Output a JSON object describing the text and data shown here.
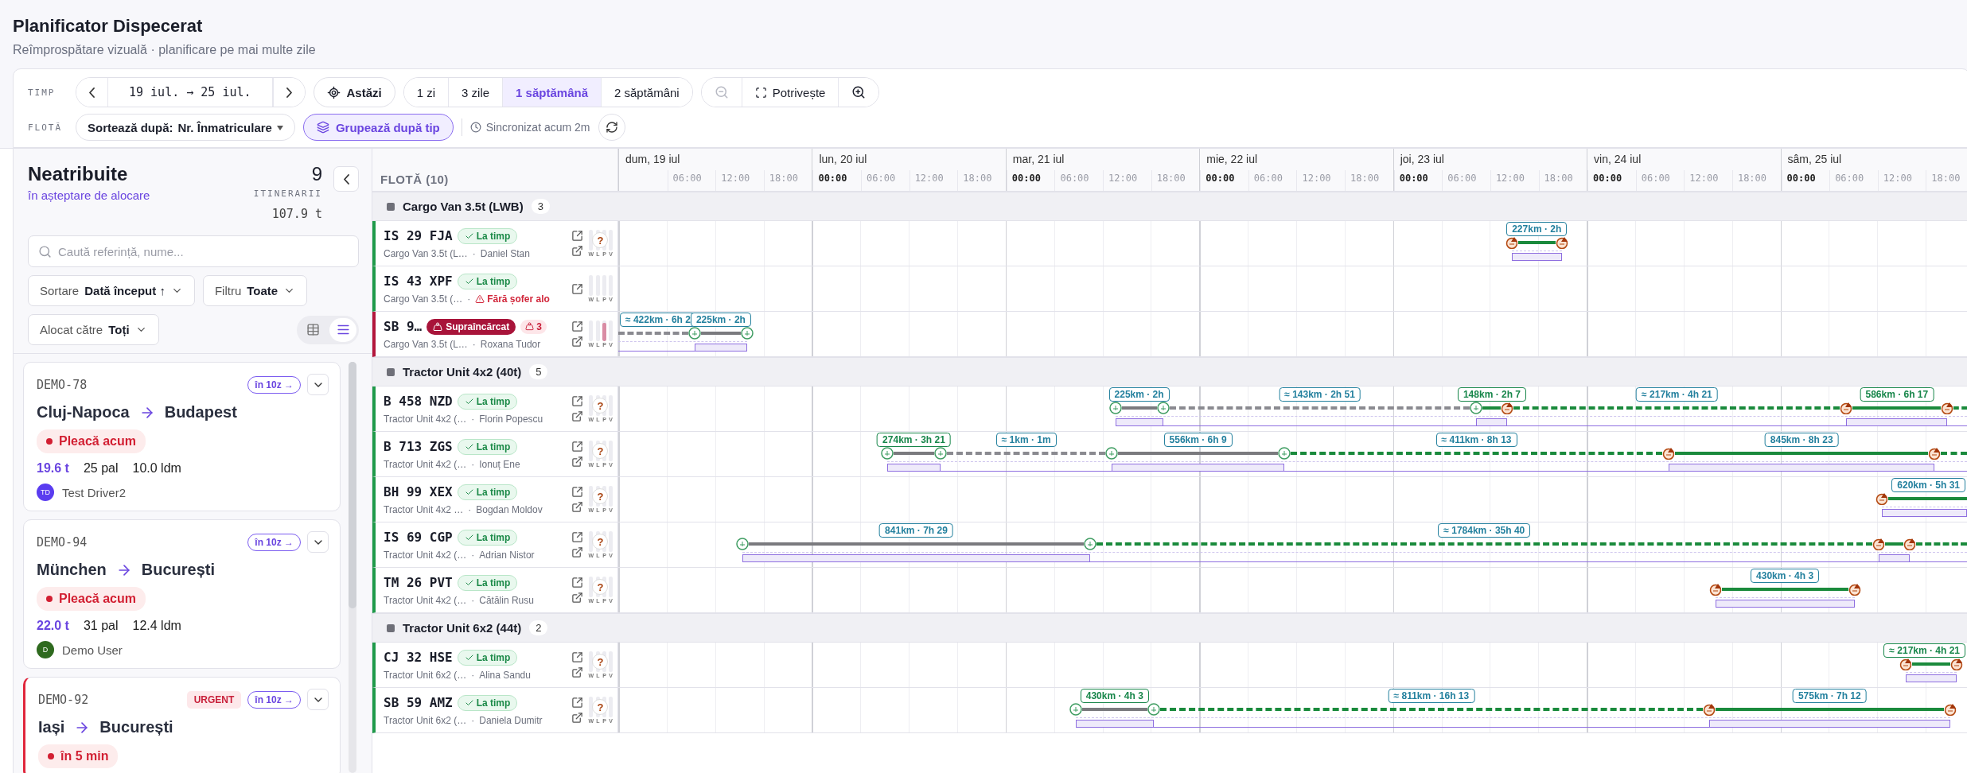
{
  "header": {
    "title": "Planificator Dispecerat",
    "subtitle": "Reîmprospătare vizuală · planificare pe mai multe zile"
  },
  "toolbar": {
    "time_label": "TIMP",
    "range": "19 iul. → 25 iul.",
    "today": "Astăzi",
    "spans": [
      {
        "label": "1 zi",
        "selected": false
      },
      {
        "label": "3 zile",
        "selected": false
      },
      {
        "label": "1 săptămână",
        "selected": true
      },
      {
        "label": "2 săptămâni",
        "selected": false
      }
    ],
    "zoom_out_disabled": true,
    "fit": "Potrivește",
    "fleet_label": "FLOTĂ",
    "sort_prefix": "Sortează după:",
    "sort_value": "Nr. Înmatriculare",
    "group_toggle": {
      "label": "Grupează după tip",
      "on": true
    },
    "sync": "Sincronizat acum 2m"
  },
  "unassigned": {
    "title": "Neatribuite",
    "subtitle": "în așteptare de alocare",
    "count": "9",
    "count_label": "ITINERARII",
    "weight": "107.9 t",
    "search_placeholder": "Caută referință, nume...",
    "filters": [
      {
        "label": "Sortare",
        "value": "Dată început ↑"
      },
      {
        "label": "Filtru",
        "value": "Toate"
      },
      {
        "label": "Alocat către",
        "value": "Toți"
      }
    ],
    "view_modes": [
      {
        "kind": "table",
        "selected": false
      },
      {
        "kind": "list",
        "selected": true
      }
    ],
    "cards": [
      {
        "id": "DEMO-78",
        "urgent": false,
        "eta": "în 10z →",
        "origin": "Cluj-Napoca",
        "destination": "Budapest",
        "status": "Pleacă acum",
        "weight": "19.6 t",
        "pallets": "25 pal",
        "ldm": "10.0 ldm",
        "driver": {
          "initials": "TD",
          "name": "Test Driver2",
          "color": "#5a3cf0"
        }
      },
      {
        "id": "DEMO-94",
        "urgent": false,
        "eta": "în 10z →",
        "origin": "München",
        "destination": "București",
        "status": "Pleacă acum",
        "weight": "22.0 t",
        "pallets": "31 pal",
        "ldm": "12.4 ldm",
        "driver": {
          "initials": "D",
          "name": "Demo User",
          "color": "#2f6a1f"
        }
      },
      {
        "id": "DEMO-92",
        "urgent": true,
        "tag": "URGENT",
        "eta": "în 10z →",
        "origin": "Iași",
        "destination": "București",
        "status": "în 5 min"
      }
    ]
  },
  "fleet": {
    "title": "FLOTĂ (10)",
    "groups": [
      {
        "name": "Cargo Van 3.5t (LWB)",
        "count": "3",
        "vehicles": [
          {
            "plate": "IS 29 FJA",
            "overloaded": false,
            "badge": "La timp",
            "type": "Cargo Van 3.5t (L…",
            "sep": "·",
            "driver": "Daniel Stan",
            "links": [
              {
                "kind": "vehicle"
              },
              {
                "kind": "driver"
              }
            ],
            "mark": "?",
            "gauges": [
              {
                "label": "W",
                "level": 0
              },
              {
                "label": "L",
                "level": 0
              },
              {
                "label": "P",
                "level": 0
              },
              {
                "label": "V",
                "level": 0
              }
            ],
            "legs": [
              {
                "kind": "planned",
                "label": "227km · 2h",
                "color": "#23809e",
                "start_stop": {
                  "alert": true
                },
                "end_stop": {
                  "alert": true
                }
              }
            ]
          },
          {
            "plate": "IS 43 XPF",
            "overloaded": false,
            "badge": "La timp",
            "type": "Cargo Van 3.5t (…",
            "sep": "·",
            "warning": "Fără șofer alo",
            "links": [
              {
                "kind": "vehicle"
              }
            ],
            "gauges": [
              {
                "label": "W",
                "level": 0
              },
              {
                "label": "L",
                "level": 0
              },
              {
                "label": "P",
                "level": 0
              },
              {
                "label": "V",
                "level": 0
              }
            ]
          },
          {
            "plate": "SB 9…",
            "overloaded": true,
            "badge": "Supraîncărcat",
            "alerts": "3",
            "type": "Cargo Van 3.5t (L…",
            "sep": "·",
            "driver": "Roxana Tudor",
            "links": [
              {
                "kind": "vehicle"
              },
              {
                "kind": "driver"
              }
            ],
            "gauges": [
              {
                "label": "W",
                "level": 0
              },
              {
                "label": "L",
                "level": 0
              },
              {
                "label": "P",
                "level": 0.9
              },
              {
                "label": "V",
                "level": 0
              }
            ],
            "legs": [
              {
                "kind": "transfer",
                "label": "≈ 422km · 6h 2",
                "color": "#23809e"
              },
              {
                "kind": "driven",
                "label": "225km · 2h",
                "color": "#23809e",
                "start_stop": {
                  "alert": false
                },
                "end_stop": {
                  "alert": false
                }
              }
            ]
          }
        ]
      },
      {
        "name": "Tractor Unit 4x2 (40t)",
        "count": "5",
        "vehicles": [
          {
            "plate": "B 458 NZD",
            "overloaded": false,
            "badge": "La timp",
            "type": "Tractor Unit 4x2 (…",
            "sep": "·",
            "driver": "Florin Popescu",
            "links": [
              {
                "kind": "vehicle"
              },
              {
                "kind": "driver"
              }
            ],
            "mark": "?",
            "gauges": [
              {
                "label": "W",
                "level": 0
              },
              {
                "label": "L",
                "level": 0
              },
              {
                "label": "P",
                "level": 0
              },
              {
                "label": "V",
                "level": 0
              }
            ],
            "legs": [
              {
                "kind": "driven",
                "label": "225km · 2h",
                "color": "#23809e",
                "start_stop": {
                  "alert": false
                },
                "end_stop": {
                  "alert": false
                }
              },
              {
                "kind": "transfer",
                "label": "≈ 143km · 2h 51",
                "color": "#23809e"
              },
              {
                "kind": "planned",
                "label": "148km · 2h 7",
                "color": "#17864a",
                "start_stop": {
                  "alert": false
                },
                "end_stop": {
                  "alert": true
                }
              },
              {
                "kind": "planned_transfer",
                "label": "≈ 217km · 4h 21",
                "color": "#23809e"
              },
              {
                "kind": "planned",
                "label": "586km · 6h 17",
                "color": "#17864a",
                "start_stop": {
                  "alert": true
                },
                "end_stop": {
                  "alert": true
                }
              },
              {
                "kind": "planned_transfer"
              }
            ]
          },
          {
            "plate": "B 713 ZGS",
            "overloaded": false,
            "badge": "La timp",
            "type": "Tractor Unit 4x2 (…",
            "sep": "·",
            "driver": "Ionuț Ene",
            "links": [
              {
                "kind": "vehicle"
              },
              {
                "kind": "driver"
              }
            ],
            "mark": "?",
            "gauges": [
              {
                "label": "W",
                "level": 0
              },
              {
                "label": "L",
                "level": 0
              },
              {
                "label": "P",
                "level": 0
              },
              {
                "label": "V",
                "level": 0
              }
            ],
            "legs": [
              {
                "kind": "driven",
                "label": "274km · 3h 21",
                "color": "#17864a",
                "start_stop": {
                  "alert": false
                },
                "end_stop": {
                  "alert": false
                }
              },
              {
                "kind": "transfer",
                "label": "≈ 1km · 1m",
                "color": "#23809e"
              },
              {
                "kind": "driven",
                "label": "556km · 6h 9",
                "color": "#23809e",
                "start_stop": {
                  "alert": false
                },
                "end_stop": {
                  "alert": false
                }
              },
              {
                "kind": "planned_transfer",
                "label": "≈ 411km · 8h 13",
                "color": "#23809e"
              },
              {
                "kind": "planned",
                "label": "845km · 8h 23",
                "color": "#23809e",
                "start_stop": {
                  "alert": true
                },
                "end_stop": {
                  "alert": true
                }
              },
              {
                "kind": "planned_transfer"
              }
            ]
          },
          {
            "plate": "BH 99 XEX",
            "overloaded": false,
            "badge": "La timp",
            "type": "Tractor Unit 4x2 …",
            "sep": "·",
            "driver": "Bogdan Moldov",
            "links": [
              {
                "kind": "vehicle"
              },
              {
                "kind": "driver"
              }
            ],
            "mark": "?",
            "gauges": [
              {
                "label": "W",
                "level": 0
              },
              {
                "label": "L",
                "level": 0
              },
              {
                "label": "P",
                "level": 0
              },
              {
                "label": "V",
                "level": 0
              }
            ],
            "legs": [
              {
                "kind": "planned",
                "label": "620km · 5h 31",
                "color": "#23809e",
                "start_stop": {
                  "alert": true
                }
              }
            ]
          },
          {
            "plate": "IS 69 CGP",
            "overloaded": false,
            "badge": "La timp",
            "type": "Tractor Unit 4x2 (…",
            "sep": "·",
            "driver": "Adrian Nistor",
            "links": [
              {
                "kind": "vehicle"
              },
              {
                "kind": "driver"
              }
            ],
            "mark": "?",
            "gauges": [
              {
                "label": "W",
                "level": 0
              },
              {
                "label": "L",
                "level": 0
              },
              {
                "label": "P",
                "level": 0
              },
              {
                "label": "V",
                "level": 0
              }
            ],
            "legs": [
              {
                "kind": "driven",
                "label": "841km · 7h 29",
                "color": "#23809e",
                "start_stop": {
                  "alert": false
                },
                "end_stop": {
                  "alert": false
                }
              },
              {
                "kind": "planned_transfer",
                "label": "≈ 1784km · 35h 40",
                "color": "#23809e"
              },
              {
                "kind": "planned",
                "start_stop": {
                  "alert": true
                },
                "end_stop": {
                  "alert": true
                }
              },
              {
                "kind": "planned_transfer"
              }
            ]
          },
          {
            "plate": "TM 26 PVT",
            "overloaded": false,
            "badge": "La timp",
            "type": "Tractor Unit 4x2 (…",
            "sep": "·",
            "driver": "Cătălin Rusu",
            "links": [
              {
                "kind": "vehicle"
              },
              {
                "kind": "driver"
              }
            ],
            "mark": "?",
            "gauges": [
              {
                "label": "W",
                "level": 0
              },
              {
                "label": "L",
                "level": 0
              },
              {
                "label": "P",
                "level": 0
              },
              {
                "label": "V",
                "level": 0
              }
            ],
            "legs": [
              {
                "kind": "planned",
                "label": "430km · 4h 3",
                "color": "#23809e",
                "start_stop": {
                  "alert": true
                },
                "end_stop": {
                  "alert": true
                }
              }
            ]
          }
        ]
      },
      {
        "name": "Tractor Unit 6x2 (44t)",
        "count": "2",
        "vehicles": [
          {
            "plate": "CJ 32 HSE",
            "overloaded": false,
            "badge": "La timp",
            "type": "Tractor Unit 6x2 (…",
            "sep": "·",
            "driver": "Alina Sandu",
            "links": [
              {
                "kind": "vehicle"
              },
              {
                "kind": "driver"
              }
            ],
            "mark": "?",
            "gauges": [
              {
                "label": "W",
                "level": 0
              },
              {
                "label": "L",
                "level": 0
              },
              {
                "label": "P",
                "level": 0
              },
              {
                "label": "V",
                "level": 0
              }
            ],
            "legs": [
              {
                "kind": "planned",
                "label": "≈ 217km · 4h 21",
                "color": "#17864a",
                "start_stop": {
                  "alert": true
                },
                "end_stop": {
                  "alert": true
                }
              }
            ]
          },
          {
            "plate": "SB 59 AMZ",
            "overloaded": false,
            "badge": "La timp",
            "type": "Tractor Unit 6x2 (…",
            "sep": "·",
            "driver": "Daniela Dumitr",
            "links": [
              {
                "kind": "vehicle"
              },
              {
                "kind": "driver"
              }
            ],
            "mark": "?",
            "gauges": [
              {
                "label": "W",
                "level": 0
              },
              {
                "label": "L",
                "level": 0
              },
              {
                "label": "P",
                "level": 0
              },
              {
                "label": "V",
                "level": 0
              }
            ],
            "legs": [
              {
                "kind": "driven",
                "label": "430km · 4h 3",
                "color": "#17864a",
                "start_stop": {
                  "alert": false
                },
                "end_stop": {
                  "alert": false
                }
              },
              {
                "kind": "planned_transfer",
                "label": "≈ 811km · 16h 13",
                "color": "#23809e"
              },
              {
                "kind": "planned",
                "label": "575km · 7h 12",
                "color": "#23809e",
                "start_stop": {
                  "alert": true
                },
                "end_stop": {
                  "alert": true
                }
              }
            ]
          }
        ]
      }
    ]
  },
  "timeline": {
    "days": [
      {
        "label": "dum, 19 iul",
        "ticks": [
          {
            "label": "06:00",
            "major": false
          },
          {
            "label": "12:00",
            "major": false
          },
          {
            "label": "18:00",
            "major": false
          }
        ]
      },
      {
        "label": "lun, 20 iul",
        "ticks": [
          {
            "label": "00:00",
            "major": true
          },
          {
            "label": "06:00",
            "major": false
          },
          {
            "label": "12:00",
            "major": false
          },
          {
            "label": "18:00",
            "major": false
          }
        ]
      },
      {
        "label": "mar, 21 iul",
        "ticks": [
          {
            "label": "00:00",
            "major": true
          },
          {
            "label": "06:00",
            "major": false
          },
          {
            "label": "12:00",
            "major": false
          },
          {
            "label": "18:00",
            "major": false
          }
        ]
      },
      {
        "label": "mie, 22 iul",
        "ticks": [
          {
            "label": "00:00",
            "major": true
          },
          {
            "label": "06:00",
            "major": false
          },
          {
            "label": "12:00",
            "major": false
          },
          {
            "label": "18:00",
            "major": false
          }
        ]
      },
      {
        "label": "joi, 23 iul",
        "ticks": [
          {
            "label": "00:00",
            "major": true
          },
          {
            "label": "06:00",
            "major": false
          },
          {
            "label": "12:00",
            "major": false
          },
          {
            "label": "18:00",
            "major": false
          }
        ]
      },
      {
        "label": "vin, 24 iul",
        "ticks": [
          {
            "label": "00:00",
            "major": true
          },
          {
            "label": "06:00",
            "major": false
          },
          {
            "label": "12:00",
            "major": false
          },
          {
            "label": "18:00",
            "major": false
          }
        ]
      },
      {
        "label": "sâm, 25 iul",
        "ticks": [
          {
            "label": "00:00",
            "major": true
          },
          {
            "label": "06:00",
            "major": false
          },
          {
            "label": "12:00",
            "major": false
          },
          {
            "label": "18:00",
            "major": false
          }
        ]
      }
    ]
  }
}
